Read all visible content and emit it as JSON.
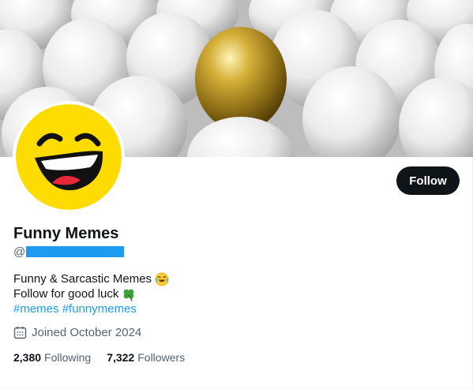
{
  "profile": {
    "name": "Funny Memes",
    "handle_prefix": "@",
    "follow_label": "Follow",
    "bio_line1": "Funny & Sarcastic Memes",
    "bio_line1_emoji": "face-with-tears-of-joy",
    "bio_line2": "Follow for good luck",
    "bio_line2_emoji": "four-leaf-clover",
    "hashtags": [
      "#memes",
      "#funnymemes"
    ],
    "joined": "Joined October 2024",
    "following_count": "2,380",
    "following_label": "Following",
    "followers_count": "7,322",
    "followers_label": "Followers"
  },
  "colors": {
    "accent": "#1d9bf0",
    "text_primary": "#0f1419",
    "text_secondary": "#536471",
    "button_bg": "#0f1419",
    "avatar_yellow": "#fedc02"
  },
  "icons": {
    "joined": "calendar-icon",
    "avatar": "laughing-face-avatar",
    "banner": "golden-egg-among-white-eggs"
  }
}
